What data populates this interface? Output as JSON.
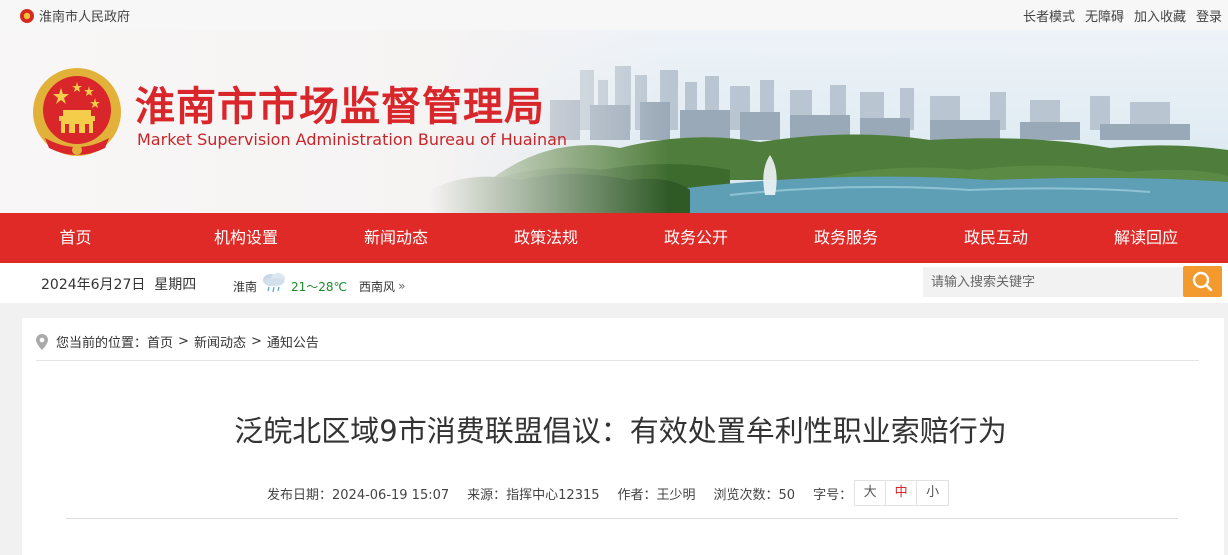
{
  "topbar": {
    "gov_name": "淮南市人民政府",
    "links": [
      "长者模式",
      "无障碍",
      "加入收藏",
      "登录"
    ]
  },
  "banner": {
    "title": "淮南市市场监督管理局",
    "subtitle": "Market Supervision Administration Bureau of Huainan"
  },
  "nav": [
    "首页",
    "机构设置",
    "新闻动态",
    "政策法规",
    "政务公开",
    "政务服务",
    "政民互动",
    "解读回应"
  ],
  "infobar": {
    "date": "2024年6月27日",
    "weekday": "星期四",
    "city": "淮南",
    "temp": "21～28℃",
    "wind": "西南风",
    "weather_icon": "rain-cloud-icon"
  },
  "search": {
    "placeholder": "请输入搜索关键字"
  },
  "breadcrumb": {
    "prefix": "您当前的位置：",
    "items": [
      "首页",
      "新闻动态",
      "通知公告"
    ],
    "separator": ">"
  },
  "article": {
    "title": "泛皖北区域9市消费联盟倡议：有效处置牟利性职业索赔行为",
    "publish": "发布日期：2024-06-19 15:07",
    "source": "来源：指挥中心12315",
    "author": "作者：王少明",
    "views": "浏览次数：50",
    "font_label": "字号：",
    "font_sizes": [
      "大",
      "中",
      "小"
    ],
    "active_font": "中"
  },
  "colors": {
    "brand_red": "#e02a27",
    "title_red": "#d8262b",
    "search_orange": "#f29a2e"
  }
}
